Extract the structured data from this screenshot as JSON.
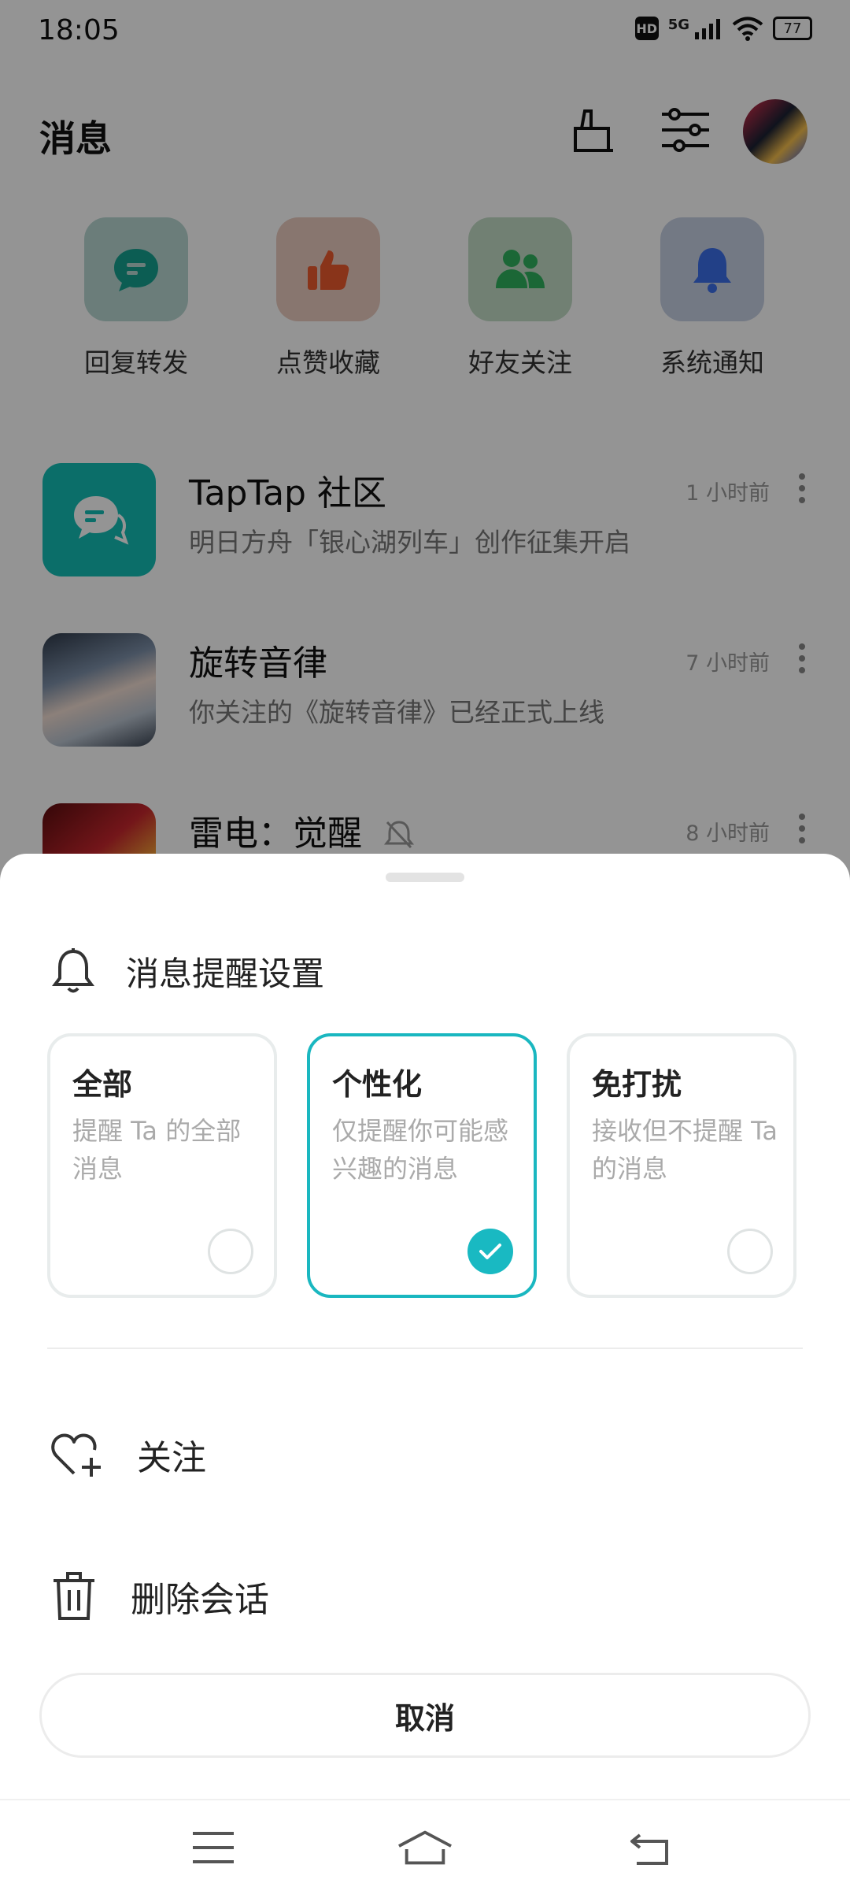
{
  "status_bar": {
    "time": "18:05",
    "hd": "HD",
    "network": "5G",
    "battery": "77",
    "icons": [
      "hd-icon",
      "signal-icon",
      "wifi-icon",
      "battery-icon"
    ]
  },
  "header": {
    "title": "消息",
    "icons": [
      "broom-clean-icon",
      "filter-settings-icon"
    ],
    "avatar": "avatar"
  },
  "categories": [
    {
      "label": "回复转发",
      "icon": "chat-bubble-icon",
      "color": "#16a08f",
      "bg": "#b9d7d3"
    },
    {
      "label": "点赞收藏",
      "icon": "thumbs-up-icon",
      "color": "#ec5a2e",
      "bg": "#ebcbc0"
    },
    {
      "label": "好友关注",
      "icon": "friends-icon",
      "color": "#2fb25d",
      "bg": "#c3dcc7"
    },
    {
      "label": "系统通知",
      "icon": "bell-icon",
      "color": "#3b6ee8",
      "bg": "#c7d0e4"
    }
  ],
  "messages": [
    {
      "title": "TapTap  社区",
      "subtitle": "明日方舟「银心湖列车」创作征集开启",
      "time": "1  小时前"
    },
    {
      "title": "旋转音律",
      "subtitle": "你关注的《旋转音律》已经正式上线",
      "time": "7  小时前"
    },
    {
      "title": "雷电：觉醒",
      "subtitle": "",
      "time": "8  小时前",
      "muted": true
    }
  ],
  "sheet": {
    "title": "消息提醒设置",
    "options": [
      {
        "title": "全部",
        "desc": "提醒  Ta  的全部消息",
        "selected": false
      },
      {
        "title": "个性化",
        "desc": "仅提醒你可能感兴趣的消息",
        "selected": true
      },
      {
        "title": "免打扰",
        "desc": "接收但不提醒  Ta  的消息",
        "selected": false
      }
    ],
    "actions": [
      {
        "label": "关注",
        "icon": "heart-plus-icon"
      },
      {
        "label": "删除会话",
        "icon": "trash-icon"
      }
    ],
    "cancel": "取消"
  },
  "colors": {
    "accent": "#1ab7c0",
    "overlay": "rgba(0,0,0,0.42)"
  },
  "navbar": [
    "menu-icon",
    "home-icon",
    "back-icon"
  ]
}
